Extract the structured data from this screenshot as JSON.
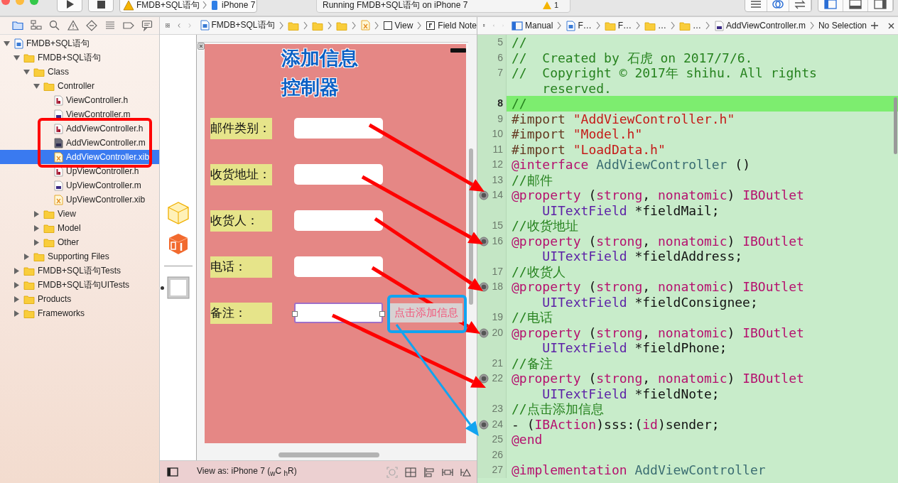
{
  "toolbar": {
    "scheme": "FMDB+SQL语句",
    "device": "iPhone 7",
    "activity": "Running FMDB+SQL语句 on iPhone 7",
    "warning_count": "1"
  },
  "navigator": {
    "tree": [
      {
        "label": "FMDB+SQL语句",
        "kind": "project",
        "expanded": true,
        "selected": false,
        "children": [
          {
            "label": "FMDB+SQL语句",
            "kind": "folder",
            "expanded": true,
            "selected": false,
            "children": [
              {
                "label": "Class",
                "kind": "folder",
                "expanded": true,
                "selected": false,
                "children": [
                  {
                    "label": "Controller",
                    "kind": "folder",
                    "expanded": true,
                    "selected": false,
                    "children": [
                      {
                        "label": "ViewController.h",
                        "kind": "h",
                        "selected": false
                      },
                      {
                        "label": "ViewController.m",
                        "kind": "m",
                        "selected": false
                      },
                      {
                        "label": "AddViewController.h",
                        "kind": "h",
                        "selected": false
                      },
                      {
                        "label": "AddViewController.m",
                        "kind": "m-dark",
                        "selected": false
                      },
                      {
                        "label": "AddViewController.xib",
                        "kind": "xib",
                        "selected": true
                      },
                      {
                        "label": "UpViewController.h",
                        "kind": "h",
                        "selected": false
                      },
                      {
                        "label": "UpViewController.m",
                        "kind": "m",
                        "selected": false
                      },
                      {
                        "label": "UpViewController.xib",
                        "kind": "xib",
                        "selected": false
                      }
                    ]
                  },
                  {
                    "label": "View",
                    "kind": "folder",
                    "expanded": false,
                    "selected": false
                  },
                  {
                    "label": "Model",
                    "kind": "folder",
                    "expanded": false,
                    "selected": false
                  },
                  {
                    "label": "Other",
                    "kind": "folder",
                    "expanded": false,
                    "selected": false
                  }
                ]
              },
              {
                "label": "Supporting Files",
                "kind": "folder",
                "expanded": false,
                "selected": false
              }
            ]
          },
          {
            "label": "FMDB+SQL语句Tests",
            "kind": "folder",
            "expanded": false,
            "selected": false
          },
          {
            "label": "FMDB+SQL语句UITests",
            "kind": "folder",
            "expanded": false,
            "selected": false
          },
          {
            "label": "Products",
            "kind": "folder",
            "expanded": false,
            "selected": false
          },
          {
            "label": "Frameworks",
            "kind": "folder",
            "expanded": false,
            "selected": false
          }
        ]
      }
    ]
  },
  "ib_jump_bar": [
    {
      "kind": "project",
      "label": "FMDB+SQL语句"
    },
    {
      "kind": "folder"
    },
    {
      "kind": "folder"
    },
    {
      "kind": "folder"
    },
    {
      "kind": "xib"
    },
    {
      "kind": "view",
      "label": "View"
    },
    {
      "kind": "field",
      "label": "Field Note"
    }
  ],
  "canvas": {
    "title": "添加信息控制器",
    "rows": [
      {
        "label": "邮件类别：",
        "selected": false
      },
      {
        "label": "收货地址：",
        "selected": false
      },
      {
        "label": "收货人：",
        "selected": false
      },
      {
        "label": "电话：",
        "selected": false
      },
      {
        "label": "备注：",
        "selected": true
      }
    ],
    "button": "点击添加信息",
    "view_as": "View as: iPhone 7 ($_{w}$C $_{h}$R)"
  },
  "code_jump_bar": [
    {
      "kind": "manual",
      "label": "Manual"
    },
    {
      "kind": "file",
      "label": "F…"
    },
    {
      "kind": "folder",
      "label": "F…"
    },
    {
      "kind": "folder",
      "label": "…"
    },
    {
      "kind": "folder",
      "label": "…"
    },
    {
      "kind": "m",
      "label": "AddViewController.m"
    },
    {
      "kind": "none",
      "label": "No Selection"
    }
  ],
  "code": [
    {
      "number": "5",
      "current": false,
      "connected": false,
      "segments": [
        {
          "tokens": [
            {
              "kind": "c",
              "text": "//"
            }
          ]
        }
      ]
    },
    {
      "number": "6",
      "current": false,
      "connected": false,
      "segments": [
        {
          "tokens": [
            {
              "kind": "c",
              "text": "//  Created by 石虎 on 2017/7/6."
            }
          ]
        }
      ]
    },
    {
      "number": "7",
      "current": false,
      "connected": false,
      "segments": [
        {
          "tokens": [
            {
              "kind": "c",
              "text": "//  Copyright © 2017年 shihu. All rights"
            }
          ]
        },
        {
          "tokens": [
            {
              "kind": "c",
              "text": "reserved."
            }
          ]
        }
      ]
    },
    {
      "number": "8",
      "current": true,
      "connected": false,
      "segments": [
        {
          "tokens": [
            {
              "kind": "c",
              "text": "//"
            }
          ]
        }
      ]
    },
    {
      "number": "9",
      "current": false,
      "connected": false,
      "segments": [
        {
          "tokens": [
            {
              "kind": "pp",
              "text": "#import "
            },
            {
              "kind": "str",
              "text": "\"AddViewController.h\""
            }
          ]
        }
      ]
    },
    {
      "number": "10",
      "current": false,
      "connected": false,
      "segments": [
        {
          "tokens": [
            {
              "kind": "pp",
              "text": "#import "
            },
            {
              "kind": "str",
              "text": "\"Model.h\""
            }
          ]
        }
      ]
    },
    {
      "number": "11",
      "current": false,
      "connected": false,
      "segments": [
        {
          "tokens": [
            {
              "kind": "pp",
              "text": "#import "
            },
            {
              "kind": "str",
              "text": "\"LoadData.h\""
            }
          ]
        }
      ]
    },
    {
      "number": "12",
      "current": false,
      "connected": false,
      "segments": [
        {
          "tokens": [
            {
              "kind": "kw",
              "text": "@interface "
            },
            {
              "kind": "type",
              "text": "AddViewController"
            },
            {
              "kind": "p",
              "text": " ()"
            }
          ]
        }
      ]
    },
    {
      "number": "13",
      "current": false,
      "connected": false,
      "segments": [
        {
          "tokens": [
            {
              "kind": "c",
              "text": "//邮件"
            }
          ]
        }
      ]
    },
    {
      "number": "14",
      "current": false,
      "connected": true,
      "segments": [
        {
          "tokens": [
            {
              "kind": "kw",
              "text": "@property"
            },
            {
              "kind": "p",
              "text": " ("
            },
            {
              "kind": "kw",
              "text": "strong"
            },
            {
              "kind": "p",
              "text": ", "
            },
            {
              "kind": "kw",
              "text": "nonatomic"
            },
            {
              "kind": "p",
              "text": ") "
            },
            {
              "kind": "kw",
              "text": "IBOutlet"
            }
          ]
        },
        {
          "tokens": [
            {
              "kind": "cls",
              "text": "UITextField"
            },
            {
              "kind": "p",
              "text": " *fieldMail;"
            }
          ]
        }
      ]
    },
    {
      "number": "15",
      "current": false,
      "connected": false,
      "segments": [
        {
          "tokens": [
            {
              "kind": "c",
              "text": "//收货地址"
            }
          ]
        }
      ]
    },
    {
      "number": "16",
      "current": false,
      "connected": true,
      "segments": [
        {
          "tokens": [
            {
              "kind": "kw",
              "text": "@property"
            },
            {
              "kind": "p",
              "text": " ("
            },
            {
              "kind": "kw",
              "text": "strong"
            },
            {
              "kind": "p",
              "text": ", "
            },
            {
              "kind": "kw",
              "text": "nonatomic"
            },
            {
              "kind": "p",
              "text": ") "
            },
            {
              "kind": "kw",
              "text": "IBOutlet"
            }
          ]
        },
        {
          "tokens": [
            {
              "kind": "cls",
              "text": "UITextField"
            },
            {
              "kind": "p",
              "text": " *fieldAddress;"
            }
          ]
        }
      ]
    },
    {
      "number": "17",
      "current": false,
      "connected": false,
      "segments": [
        {
          "tokens": [
            {
              "kind": "c",
              "text": "//收货人"
            }
          ]
        }
      ]
    },
    {
      "number": "18",
      "current": false,
      "connected": true,
      "segments": [
        {
          "tokens": [
            {
              "kind": "kw",
              "text": "@property"
            },
            {
              "kind": "p",
              "text": " ("
            },
            {
              "kind": "kw",
              "text": "strong"
            },
            {
              "kind": "p",
              "text": ", "
            },
            {
              "kind": "kw",
              "text": "nonatomic"
            },
            {
              "kind": "p",
              "text": ") "
            },
            {
              "kind": "kw",
              "text": "IBOutlet"
            }
          ]
        },
        {
          "tokens": [
            {
              "kind": "cls",
              "text": "UITextField"
            },
            {
              "kind": "p",
              "text": " *fieldConsignee;"
            }
          ]
        }
      ]
    },
    {
      "number": "19",
      "current": false,
      "connected": false,
      "segments": [
        {
          "tokens": [
            {
              "kind": "c",
              "text": "//电话"
            }
          ]
        }
      ]
    },
    {
      "number": "20",
      "current": false,
      "connected": true,
      "segments": [
        {
          "tokens": [
            {
              "kind": "kw",
              "text": "@property"
            },
            {
              "kind": "p",
              "text": " ("
            },
            {
              "kind": "kw",
              "text": "strong"
            },
            {
              "kind": "p",
              "text": ", "
            },
            {
              "kind": "kw",
              "text": "nonatomic"
            },
            {
              "kind": "p",
              "text": ") "
            },
            {
              "kind": "kw",
              "text": "IBOutlet"
            }
          ]
        },
        {
          "tokens": [
            {
              "kind": "cls",
              "text": "UITextField"
            },
            {
              "kind": "p",
              "text": " *fieldPhone;"
            }
          ]
        }
      ]
    },
    {
      "number": "21",
      "current": false,
      "connected": false,
      "segments": [
        {
          "tokens": [
            {
              "kind": "c",
              "text": "//备注"
            }
          ]
        }
      ]
    },
    {
      "number": "22",
      "current": false,
      "connected": true,
      "segments": [
        {
          "tokens": [
            {
              "kind": "kw",
              "text": "@property"
            },
            {
              "kind": "p",
              "text": " ("
            },
            {
              "kind": "kw",
              "text": "strong"
            },
            {
              "kind": "p",
              "text": ", "
            },
            {
              "kind": "kw",
              "text": "nonatomic"
            },
            {
              "kind": "p",
              "text": ") "
            },
            {
              "kind": "kw",
              "text": "IBOutlet"
            }
          ]
        },
        {
          "tokens": [
            {
              "kind": "cls",
              "text": "UITextField"
            },
            {
              "kind": "p",
              "text": " *fieldNote;"
            }
          ]
        }
      ]
    },
    {
      "number": "23",
      "current": false,
      "connected": false,
      "segments": [
        {
          "tokens": [
            {
              "kind": "c",
              "text": "//点击添加信息"
            }
          ]
        }
      ]
    },
    {
      "number": "24",
      "current": false,
      "connected": true,
      "segments": [
        {
          "tokens": [
            {
              "kind": "p",
              "text": "- ("
            },
            {
              "kind": "kw",
              "text": "IBAction"
            },
            {
              "kind": "p",
              "text": ")sss:("
            },
            {
              "kind": "kw",
              "text": "id"
            },
            {
              "kind": "p",
              "text": ")sender;"
            }
          ]
        }
      ]
    },
    {
      "number": "25",
      "current": false,
      "connected": false,
      "segments": [
        {
          "tokens": [
            {
              "kind": "kw",
              "text": "@end"
            }
          ]
        }
      ]
    },
    {
      "number": "26",
      "current": false,
      "connected": false
    },
    {
      "number": "27",
      "current": false,
      "connected": false,
      "segments": [
        {
          "tokens": [
            {
              "kind": "kw",
              "text": "@implementation "
            },
            {
              "kind": "type",
              "text": "AddViewController"
            }
          ]
        }
      ]
    }
  ],
  "annotations": [
    {
      "kind": "arrow",
      "color": "#ff0000"
    },
    {
      "kind": "arrow",
      "color": "#ff0000"
    },
    {
      "kind": "arrow",
      "color": "#ff0000"
    },
    {
      "kind": "arrow",
      "color": "#ff0000"
    },
    {
      "kind": "arrow",
      "color": "#ff0000"
    },
    {
      "kind": "arrow",
      "color": "#12a4f0"
    },
    {
      "kind": "frame",
      "color": "#ff0000"
    },
    {
      "kind": "frame",
      "color": "#12a4f0"
    }
  ]
}
